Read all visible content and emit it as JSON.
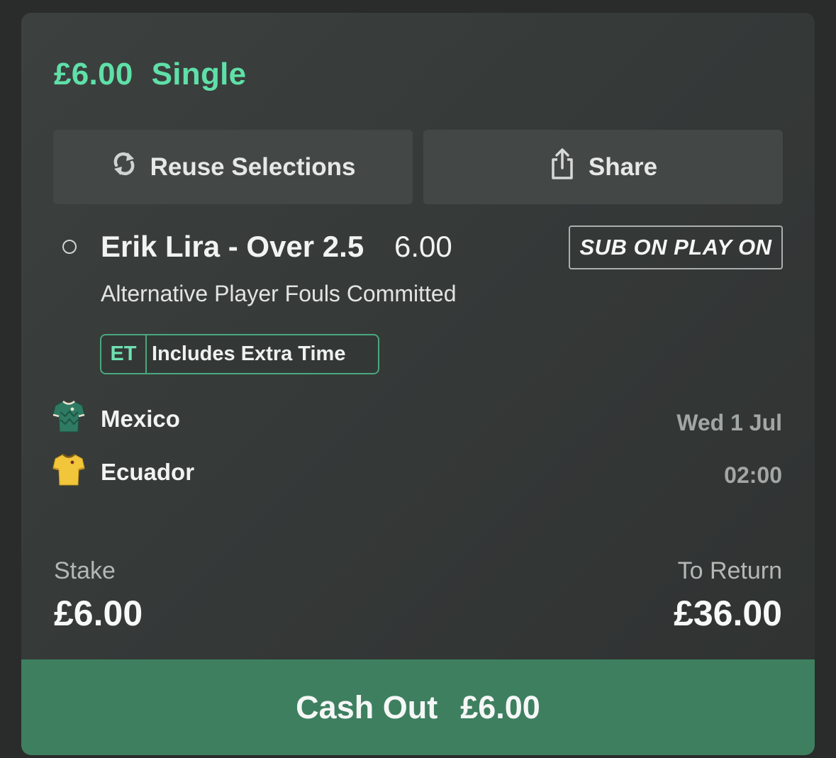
{
  "bet": {
    "stake_amount": "£6.00",
    "bet_type": "Single"
  },
  "actions": {
    "reuse_label": "Reuse Selections",
    "share_label": "Share"
  },
  "selection": {
    "title": "Erik Lira - Over 2.5",
    "odds": "6.00",
    "badge": "SUB ON PLAY ON",
    "market": "Alternative Player Fouls Committed",
    "et_code": "ET",
    "et_label": "Includes Extra Time"
  },
  "match": {
    "home_team": "Mexico",
    "away_team": "Ecuador",
    "date": "Wed 1 Jul",
    "time": "02:00"
  },
  "summary": {
    "stake_label": "Stake",
    "stake_value": "£6.00",
    "return_label": "To Return",
    "return_value": "£36.00"
  },
  "cashout": {
    "label": "Cash Out",
    "amount": "£6.00"
  },
  "icons": {
    "reuse": "refresh-icon",
    "share": "share-icon",
    "home_kit": "green-shirt-icon",
    "away_kit": "yellow-shirt-icon"
  },
  "colors": {
    "accent_green": "#5fe0a8",
    "cashout_bg": "#3e7f60",
    "card_bg": "#373b3a"
  }
}
